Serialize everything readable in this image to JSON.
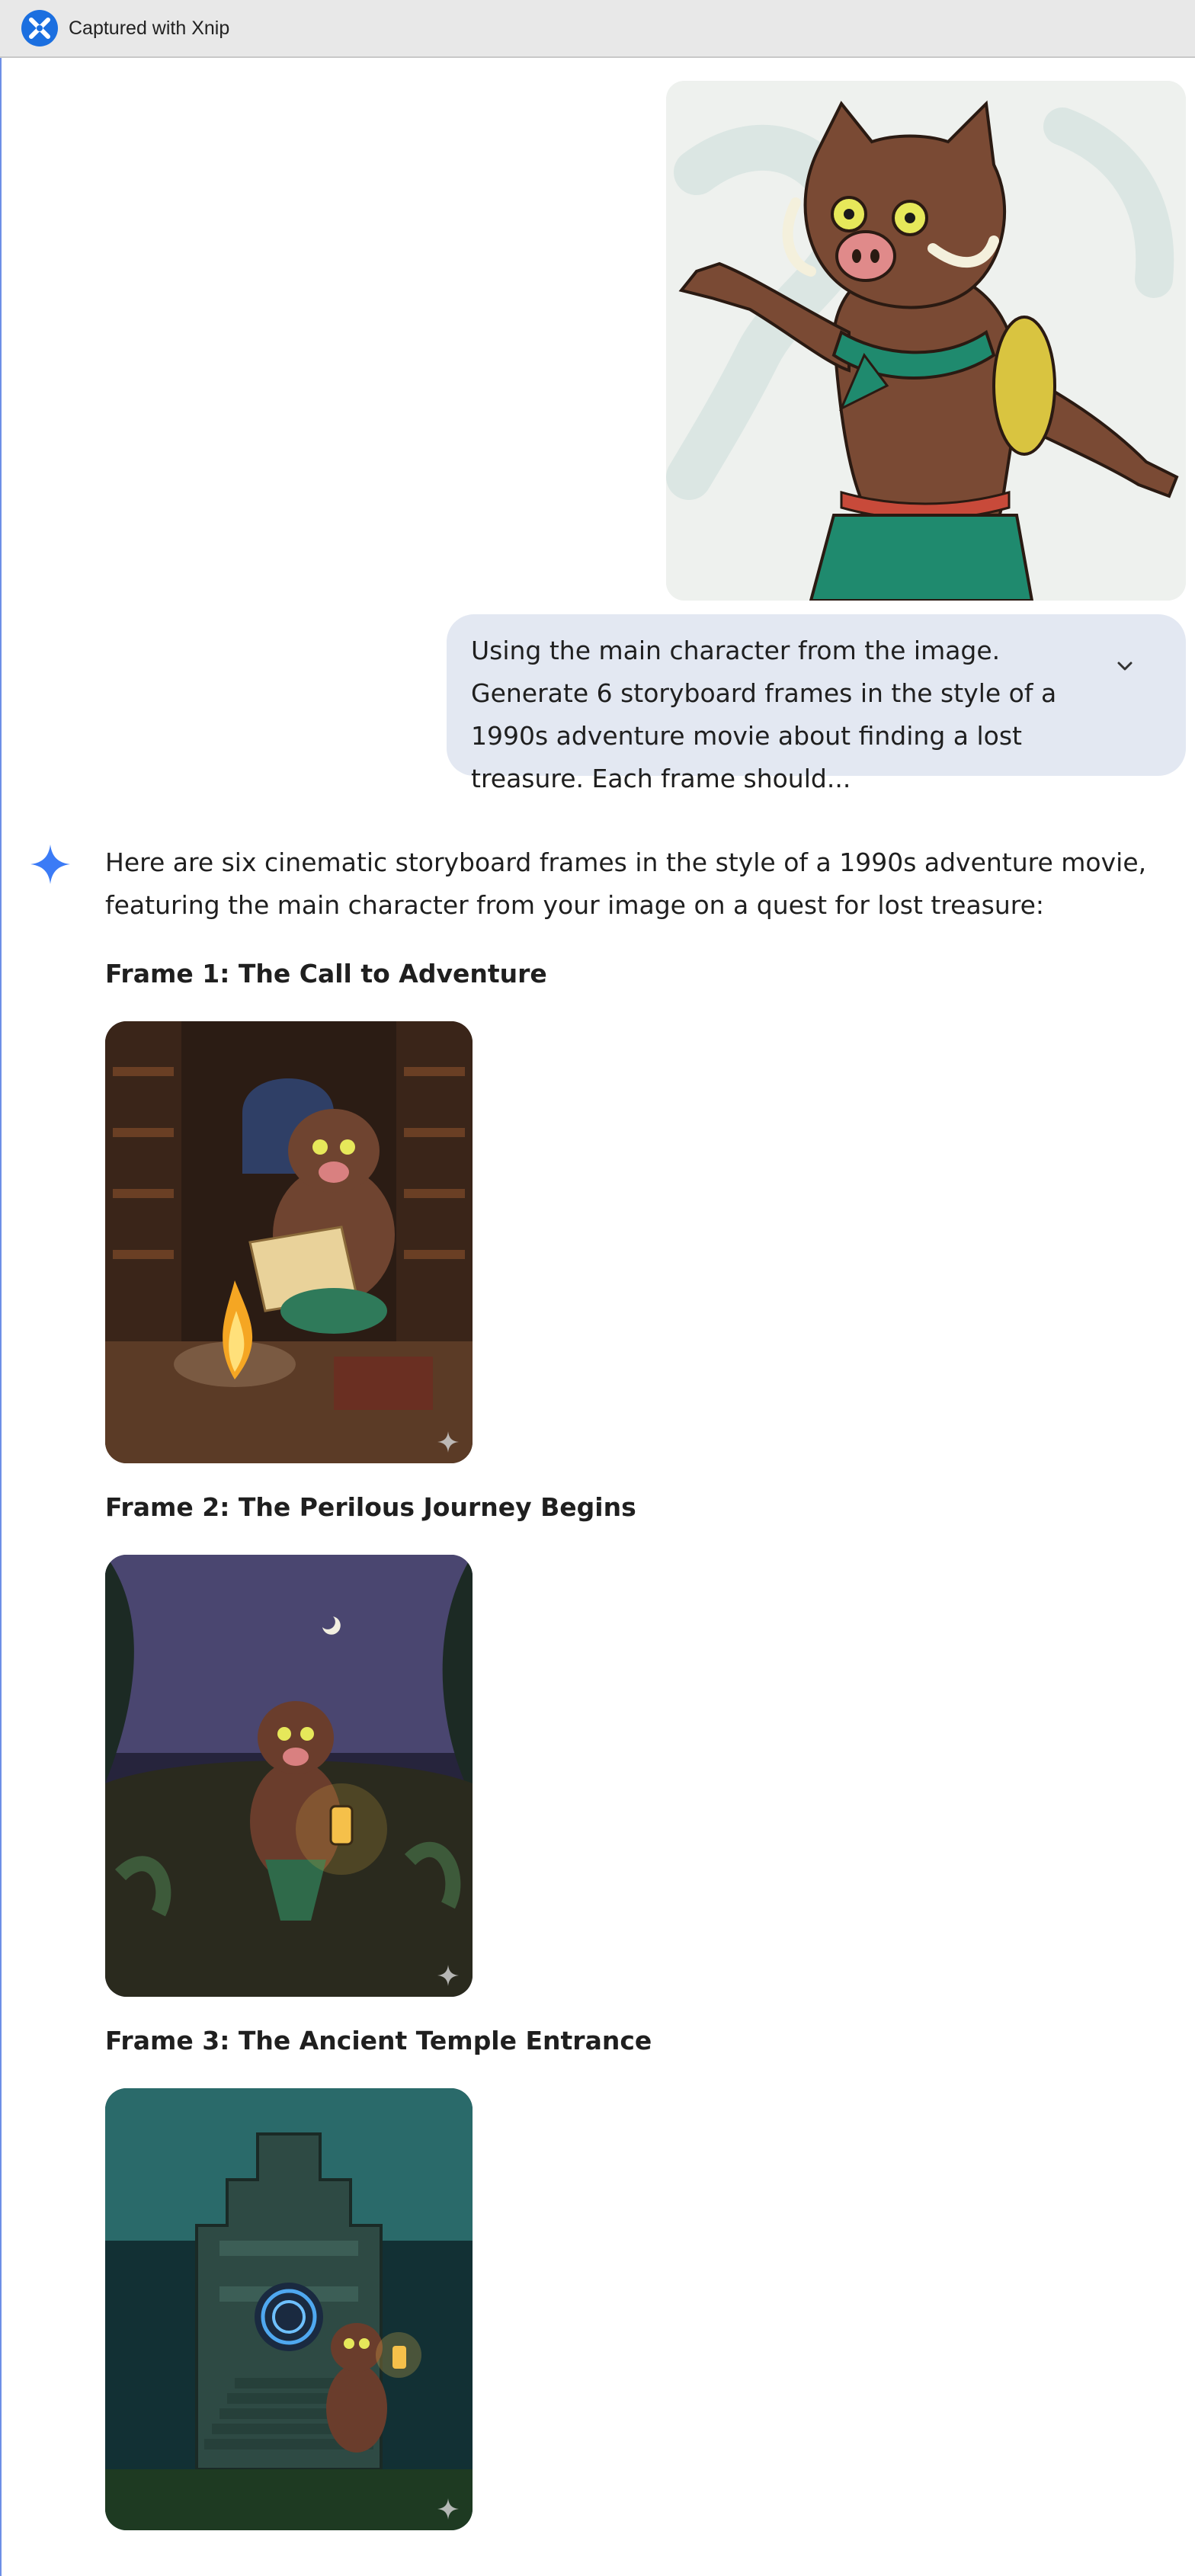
{
  "window": {
    "title": "Captured with Xnip",
    "app_icon": "xnip-logo-icon"
  },
  "user_message": {
    "image_icon": "boar-character-image",
    "prompt": "Using the main character from the image. Generate 6 storyboard frames in the style of a 1990s adventure movie about finding a lost treasure. Each frame should...",
    "expand_icon": "chevron-down-icon"
  },
  "response": {
    "avatar_icon": "gemini-sparkle-icon",
    "intro": "Here are six cinematic storyboard frames in the style of a 1990s adventure movie, featuring the main character from your image on a quest for lost treasure:",
    "frames": [
      {
        "heading": "Frame 1: The Call to Adventure",
        "image_icon": "boar-reading-map-campfire-image"
      },
      {
        "heading": "Frame 2: The Perilous Journey Begins",
        "image_icon": "boar-with-lantern-jungle-night-image"
      },
      {
        "heading": "Frame 3: The Ancient Temple Entrance",
        "image_icon": "boar-at-temple-entrance-image"
      }
    ]
  },
  "colors": {
    "accent": "#1b6fe0",
    "bubble": "#e3e8f2",
    "gemini_blue": "#3b7bf6"
  }
}
